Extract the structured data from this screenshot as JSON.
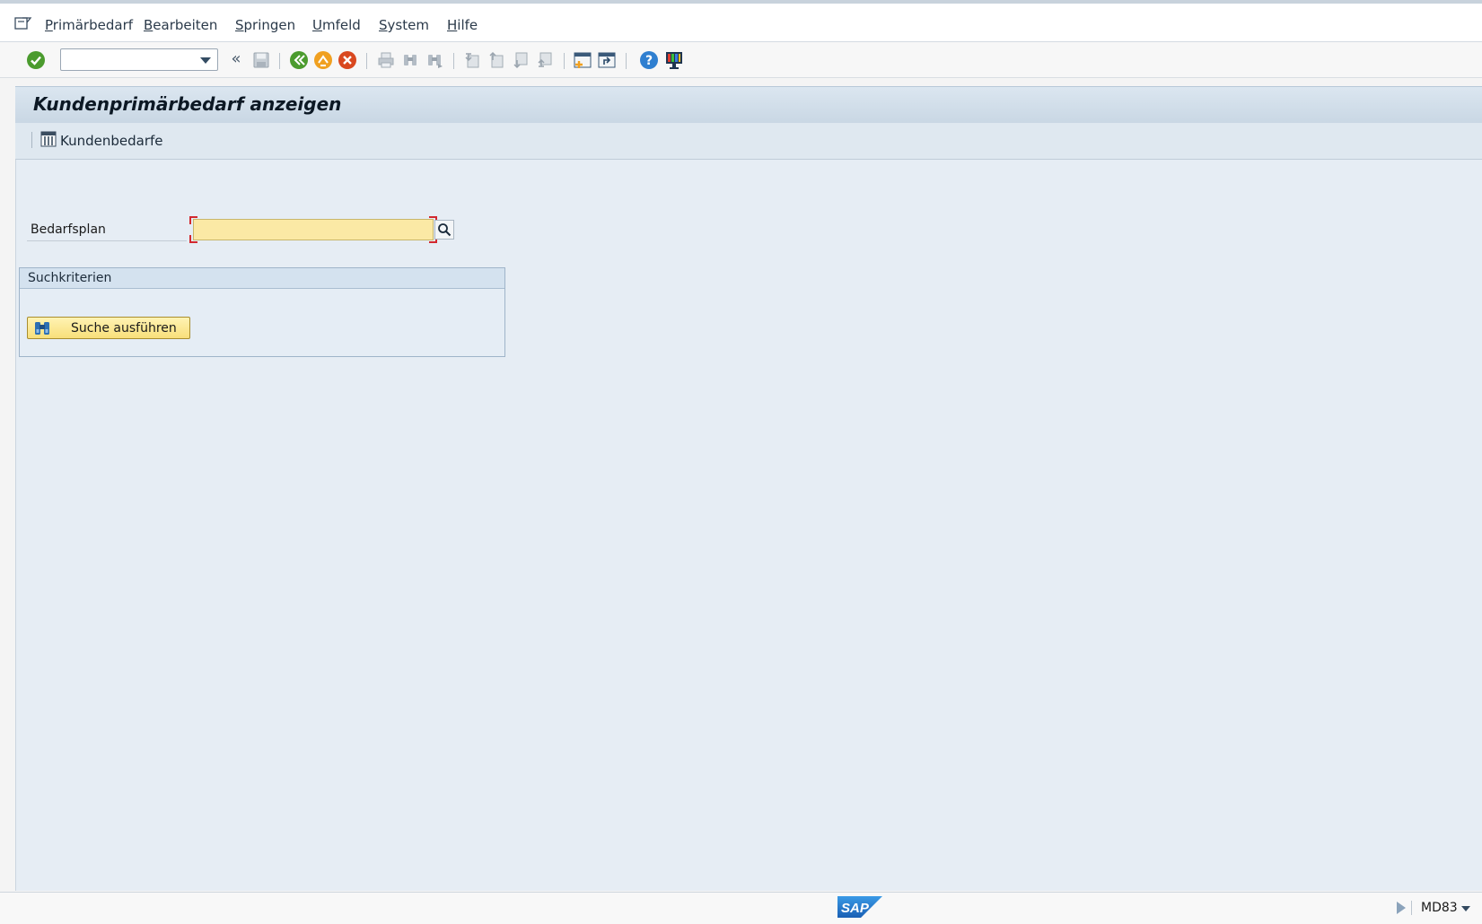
{
  "menu": {
    "items": [
      {
        "key": "P",
        "rest": "rimärbedarf"
      },
      {
        "key": "B",
        "rest": "earbeiten"
      },
      {
        "key": "S",
        "rest": "pringen"
      },
      {
        "key": "U",
        "rest": "mfeld"
      },
      {
        "key": "S",
        "rest": "ystem"
      },
      {
        "key": "H",
        "rest": "ilfe"
      }
    ]
  },
  "toolbar": {
    "command_field": "",
    "back_chevron": "«"
  },
  "title": "Kundenprimärbedarf anzeigen",
  "app_toolbar": {
    "kundenbedarfe_label": "Kundenbedarfe"
  },
  "form": {
    "bedarfsplan_label": "Bedarfsplan",
    "bedarfsplan_value": ""
  },
  "search_group": {
    "title": "Suchkriterien",
    "button_label": "Suche ausführen"
  },
  "status": {
    "logo_text": "SAP",
    "transaction_code": "MD83"
  },
  "colors": {
    "input_required_bg": "#fbe9a5",
    "title_bar": "#c9d7e4",
    "work_area": "#e6edf4",
    "sap_blue": "#1f6fc6"
  }
}
